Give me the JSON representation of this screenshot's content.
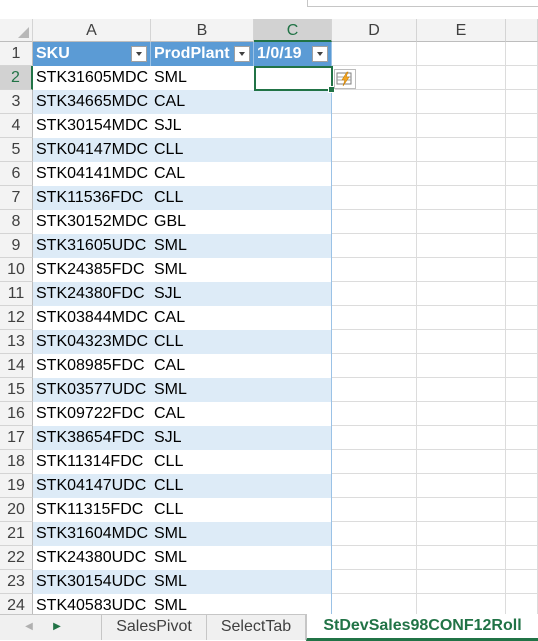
{
  "columns": [
    "A",
    "B",
    "C",
    "D",
    "E"
  ],
  "row_numbers": [
    "1",
    "2",
    "3",
    "4",
    "5",
    "6",
    "7",
    "8",
    "9",
    "10",
    "11",
    "12",
    "13",
    "14",
    "15",
    "16",
    "17",
    "18",
    "19",
    "20",
    "21",
    "22",
    "23",
    "24"
  ],
  "table": {
    "headers": [
      "SKU",
      "ProdPlant",
      "1/0/19"
    ],
    "rows": [
      [
        "STK31605MDC",
        "SML"
      ],
      [
        "STK34665MDC",
        "CAL"
      ],
      [
        "STK30154MDC",
        "SJL"
      ],
      [
        "STK04147MDC",
        "CLL"
      ],
      [
        "STK04141MDC",
        "CAL"
      ],
      [
        "STK11536FDC",
        "CLL"
      ],
      [
        "STK30152MDC",
        "GBL"
      ],
      [
        "STK31605UDC",
        "SML"
      ],
      [
        "STK24385FDC",
        "SML"
      ],
      [
        "STK24380FDC",
        "SJL"
      ],
      [
        "STK03844MDC",
        "CAL"
      ],
      [
        "STK04323MDC",
        "CLL"
      ],
      [
        "STK08985FDC",
        "CAL"
      ],
      [
        "STK03577UDC",
        "SML"
      ],
      [
        "STK09722FDC",
        "CAL"
      ],
      [
        "STK38654FDC",
        "SJL"
      ],
      [
        "STK11314FDC",
        "CLL"
      ],
      [
        "STK04147UDC",
        "CLL"
      ],
      [
        "STK11315FDC",
        "CLL"
      ],
      [
        "STK31604MDC",
        "SML"
      ],
      [
        "STK24380UDC",
        "SML"
      ],
      [
        "STK30154UDC",
        "SML"
      ],
      [
        "STK40583UDC",
        "SML"
      ]
    ]
  },
  "selection": {
    "active_column": "C",
    "active_row": "2"
  },
  "sheet_tabs": [
    "SalesPivot",
    "SelectTab",
    "StDevSales98CONF12Roll"
  ],
  "active_tab": "StDevSales98CONF12Roll",
  "icons": {
    "quick_analysis": "flash-fill-icon",
    "next_sheet": "triangle-right-icon",
    "prev_sheet": "triangle-left-icon"
  },
  "colors": {
    "accent": "#217346",
    "table_header": "#5b9bd5",
    "band": "#ddebf7"
  }
}
